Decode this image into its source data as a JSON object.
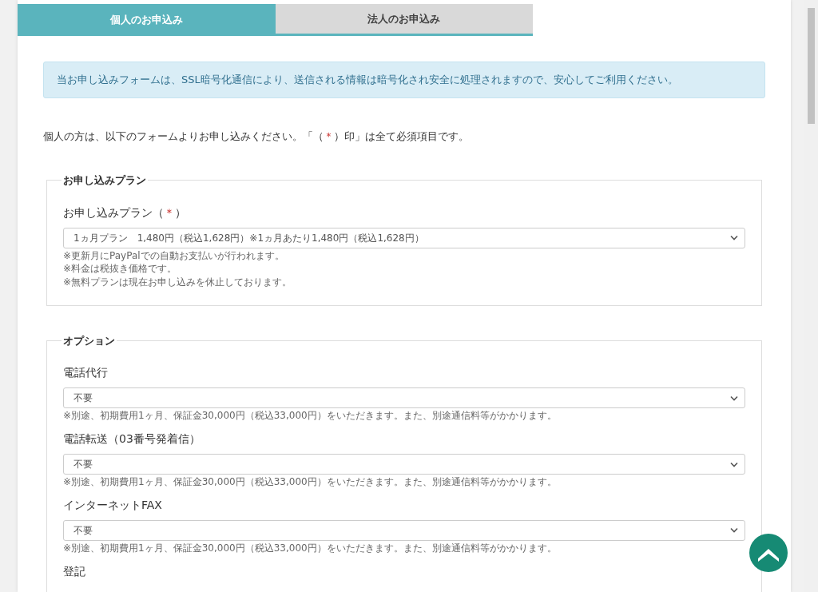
{
  "tabs": [
    {
      "label": "個人のお申込み",
      "selected": true
    },
    {
      "label": "法人のお申込み",
      "selected": false
    }
  ],
  "notice": "当お申し込みフォームは、SSL暗号化通信により、送信される情報は暗号化され安全に処理されますので、安心してご利用ください。",
  "intro": {
    "before": "個人の方は、以下のフォームよりお申し込みください。「（",
    "mark": "＊",
    "after": "）印」は全て必須項目です。"
  },
  "sections": [
    {
      "legend": "お申し込みプラン",
      "fields": [
        {
          "label": "お申し込みプラン",
          "required": {
            "open": "（",
            "mark": "＊",
            "close": "）"
          },
          "value": "1ヵ月プラン　1,480円（税込1,628円）※1ヵ月あたり1,480円（税込1,628円）",
          "notes": [
            "※更新月にPayPalでの自動お支払いが行われます。",
            "※料金は税抜き価格です。",
            "※無料プランは現在お申し込みを休止しております。"
          ]
        }
      ]
    },
    {
      "legend": "オプション",
      "fields": [
        {
          "label": "電話代行",
          "value": "不要",
          "notes": [
            "※別途、初期費用1ヶ月、保証金30,000円（税込33,000円）をいただきます。また、別途通信料等がかかります。"
          ]
        },
        {
          "label": "電話転送（03番号発着信）",
          "value": "不要",
          "notes": [
            "※別途、初期費用1ヶ月、保証金30,000円（税込33,000円）をいただきます。また、別途通信料等がかかります。"
          ]
        },
        {
          "label": "インターネットFAX",
          "value": "不要",
          "notes": [
            "※別途、初期費用1ヶ月、保証金30,000円（税込33,000円）をいただきます。また、別途通信料等がかかります。"
          ]
        },
        {
          "label": "登記"
        }
      ]
    }
  ]
}
